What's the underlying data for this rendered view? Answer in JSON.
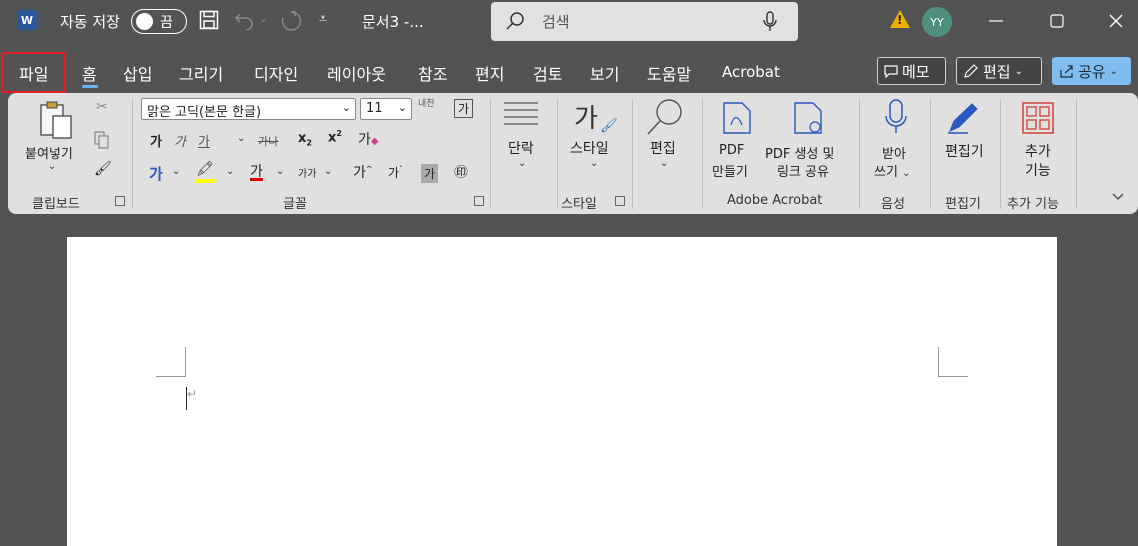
{
  "titlebar": {
    "app_icon": "W",
    "autosave_label": "자동 저장",
    "autosave_state": "끔",
    "doc_title": "문서3 -...",
    "search_placeholder": "검색",
    "avatar_initials": "YY"
  },
  "menu": {
    "tabs": [
      "파일",
      "홈",
      "삽입",
      "그리기",
      "디자인",
      "레이아웃",
      "참조",
      "편지",
      "검토",
      "보기",
      "도움말",
      "Acrobat"
    ],
    "memo": "메모",
    "edit": "편집",
    "share": "공유"
  },
  "ribbon": {
    "clipboard": {
      "paste": "붙여넣기",
      "group": "클립보드"
    },
    "font": {
      "font_name": "맑은 고딕(본문 한글)",
      "font_size": "11",
      "bold": "가",
      "italic": "가",
      "underline": "가",
      "strike": "가나",
      "sub": "x",
      "sup": "x",
      "font_color": "가",
      "size_change": "가가",
      "grow": "가",
      "shrink": "가",
      "shade": "가",
      "enclose": "㊞",
      "clear": "가",
      "phonetic": "내천",
      "char_border": "가",
      "group": "글꼴"
    },
    "paragraph": {
      "label": "단락"
    },
    "styles": {
      "label": "스타일",
      "group": "스타일"
    },
    "editing": {
      "label": "편집"
    },
    "acrobat": {
      "pdf_create_1": "PDF",
      "pdf_create_2": "만들기",
      "pdf_link_1": "PDF 생성 및",
      "pdf_link_2": "링크 공유",
      "group": "Adobe Acrobat"
    },
    "voice": {
      "label_1": "받아",
      "label_2": "쓰기",
      "group": "음성"
    },
    "editor": {
      "label": "편집기",
      "group": "편집기"
    },
    "addins": {
      "label_1": "추가",
      "label_2": "기능",
      "group": "추가 기능"
    }
  },
  "colors": {
    "titlebar_bg": "#535353",
    "ribbon_bg": "#e0e0e0",
    "accent_blue": "#2b579a",
    "share_blue": "#7fbdf0",
    "highlight_yellow": "#ffff00",
    "font_red": "#e00000",
    "file_frame_red": "#e02020"
  }
}
